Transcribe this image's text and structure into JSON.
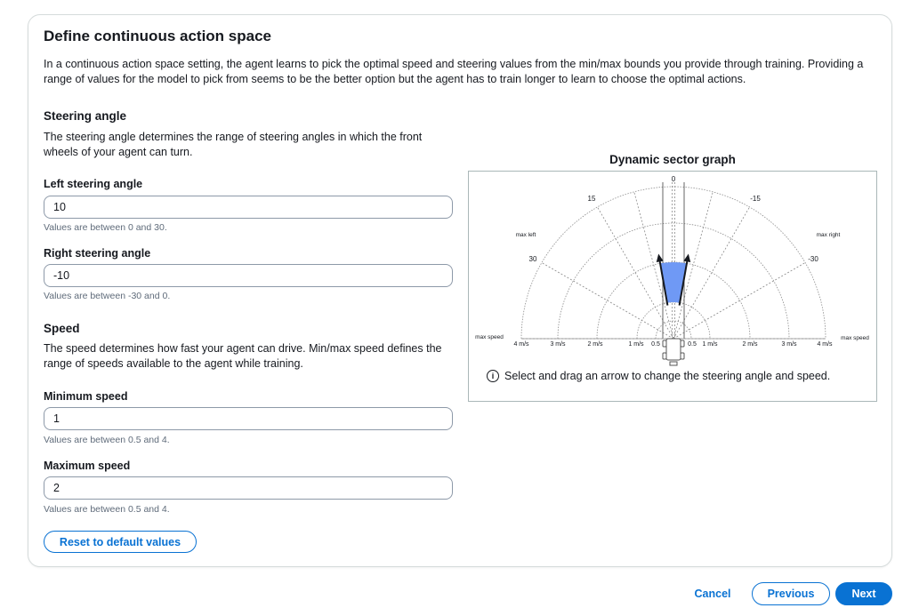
{
  "page": {
    "title": "Define continuous action space",
    "intro": "In a continuous action space setting, the agent learns to pick the optimal speed and steering values from the min/max bounds you provide through training. Providing a range of values for the model to pick from seems to be the better option but the agent has to train longer to learn to choose the optimal actions."
  },
  "steering": {
    "title": "Steering angle",
    "description": "The steering angle determines the range of steering angles in which the front wheels of your agent can turn.",
    "left": {
      "label": "Left steering angle",
      "value": "10",
      "hint": "Values are between 0 and 30."
    },
    "right": {
      "label": "Right steering angle",
      "value": "-10",
      "hint": "Values are between -30 and 0."
    }
  },
  "speed": {
    "title": "Speed",
    "description": "The speed determines how fast your agent can drive. Min/max speed defines the range of speeds available to the agent while training.",
    "min": {
      "label": "Minimum speed",
      "value": "1",
      "hint": "Values are between 0.5 and 4."
    },
    "max": {
      "label": "Maximum speed",
      "value": "2",
      "hint": "Values are between 0.5 and 4."
    }
  },
  "reset_label": "Reset to default values",
  "graph": {
    "title": "Dynamic sector graph",
    "note": "Select and drag an arrow to change the steering angle and speed.",
    "angle_labels": {
      "zero": "0",
      "pos15": "15",
      "neg15": "-15",
      "pos30": "30",
      "neg30": "-30"
    },
    "max_left": "max left",
    "max_right": "max right",
    "max_speed_left": "max speed",
    "max_speed_right": "max speed",
    "speed_ticks_left": [
      "4 m/s",
      "3 m/s",
      "2 m/s",
      "1 m/s",
      "0.5"
    ],
    "speed_ticks_right": [
      "0.5",
      "1 m/s",
      "2 m/s",
      "3 m/s",
      "4 m/s"
    ],
    "sector": {
      "left_angle": 10,
      "right_angle": -10,
      "min_speed": 1,
      "max_speed": 2
    },
    "colors": {
      "sector_fill": "#6f99f5",
      "arrow": "#16191f",
      "grid": "#8c8c8c"
    }
  },
  "footer": {
    "cancel": "Cancel",
    "previous": "Previous",
    "next": "Next"
  }
}
